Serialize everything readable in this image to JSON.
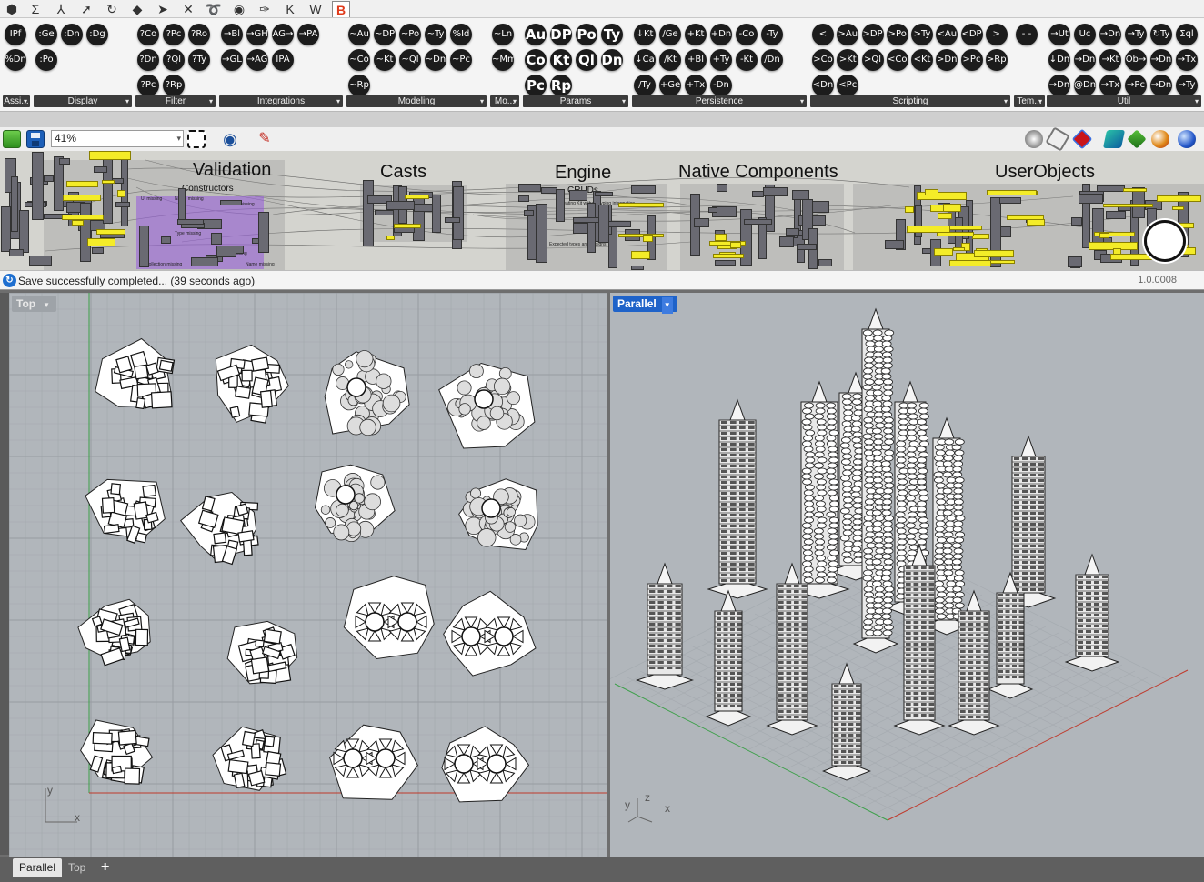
{
  "tab_strip": {
    "items": [
      {
        "glyph": "⬢",
        "name": "params-tab-icon"
      },
      {
        "glyph": "Σ",
        "name": "maths-tab-icon"
      },
      {
        "glyph": "⅄",
        "name": "sets-tab-icon"
      },
      {
        "glyph": "➚",
        "name": "vector-tab-icon"
      },
      {
        "glyph": "↻",
        "name": "curve-tab-icon"
      },
      {
        "glyph": "◆",
        "name": "surface-tab-icon"
      },
      {
        "glyph": "➤",
        "name": "mesh-tab-icon"
      },
      {
        "glyph": "✕",
        "name": "intersect-tab-icon"
      },
      {
        "glyph": "➰",
        "name": "transform-tab-icon"
      },
      {
        "glyph": "◉",
        "name": "display-tab-icon"
      },
      {
        "glyph": "✑",
        "name": "plugin-tab-icon"
      },
      {
        "glyph": "K",
        "name": "kangaroo-tab-icon"
      },
      {
        "glyph": "W",
        "name": "weaverbird-tab-icon"
      },
      {
        "glyph": "B",
        "name": "selected-plugin-tab-icon"
      }
    ]
  },
  "ribbon": {
    "panels": [
      {
        "label": "Assi...",
        "buttons": [
          "IPf",
          "%Dn"
        ]
      },
      {
        "label": "Display",
        "buttons": [
          ":Ge",
          ":Dn",
          ":Dg",
          ":Po"
        ]
      },
      {
        "label": "Filter",
        "buttons": [
          "?Co",
          "?Pc",
          "?Ro",
          "?Dn",
          "?Ql",
          "?Ty",
          "?Pc",
          "?Rp"
        ]
      },
      {
        "label": "Integrations",
        "buttons": [
          "→Bl",
          "→GH",
          "AG→",
          "→PA",
          "→GL",
          "→AG",
          "IPA"
        ]
      },
      {
        "label": "Modeling",
        "buttons": [
          "~Au",
          "~DP",
          "~Po",
          "~Ty",
          "%Id",
          "~Co",
          "~Kt",
          "~Ql",
          "~Dn",
          "~Pc",
          "~Rp"
        ]
      },
      {
        "label": "Mo...",
        "buttons": [
          "~Ln",
          "~Mm"
        ]
      },
      {
        "label": "Params",
        "buttons": [
          "Au",
          "DP",
          "Po",
          "Ty",
          "Co",
          "Kt",
          "Ql",
          "Dn",
          "Pc",
          "Rp"
        ]
      },
      {
        "label": "Persistence",
        "buttons": [
          "↓Kt",
          "/Ge",
          "+Kt",
          "+Dn",
          "-Co",
          "-Ty",
          "↓Ca",
          "/Kt",
          "+Bl",
          "+Ty",
          "-Kt",
          "/Dn",
          "/Ty",
          "+Ge",
          "+Tx",
          "-Dn"
        ]
      },
      {
        "label": "Scripting",
        "buttons": [
          "<",
          ">Au",
          ">DP",
          ">Po",
          ">Ty",
          "<Au",
          "<DP",
          ">",
          ">Co",
          ">Kt",
          ">Ql",
          "<Co",
          "<Kt",
          ">Dn",
          ">Pc",
          ">Rp",
          "<Dn",
          "<Pc"
        ]
      },
      {
        "label": "Tem...",
        "buttons": [
          "- -"
        ]
      },
      {
        "label": "Util",
        "buttons": [
          "→Ut",
          "Uc",
          "→Dn",
          "→Ty",
          "↻Ty",
          "Σql",
          "↓Dn",
          "→Dn",
          "→Kt",
          "Ob→",
          "→Dn",
          "→Tx",
          "→Dn",
          "@Dn",
          "→Tx",
          "→Pc",
          "→Dn",
          "→Ty"
        ]
      }
    ]
  },
  "toolbar": {
    "zoom_value": "41%"
  },
  "canvas": {
    "groups": [
      {
        "title": "Validation",
        "sub": "Constructors"
      },
      {
        "title": "Casts",
        "sub": ""
      },
      {
        "title": "Engine",
        "sub": "CRUDs"
      },
      {
        "title": "Native Components",
        "sub": ""
      },
      {
        "title": "UserObjects",
        "sub": ""
      }
    ],
    "validation_notes": [
      "UI missing",
      "Name missing",
      "Name missing",
      "Type missing",
      "Name missing",
      "Name missing",
      "Collection missing"
    ],
    "engine_notes": [
      "Creating Kit without typing information",
      "Expected types and designs"
    ]
  },
  "status_bar": {
    "message": "Save successfully completed... (39 seconds ago)",
    "version": "1.0.0008"
  },
  "viewports": {
    "top": {
      "label": "Top"
    },
    "parallel": {
      "label": "Parallel"
    },
    "axes_top": {
      "x": "x",
      "y": "y"
    },
    "axes_parallel": {
      "x": "x",
      "y": "y",
      "z": "z"
    }
  },
  "bottom_tabs": {
    "items": [
      "Parallel",
      "Top"
    ],
    "add": "+"
  },
  "colors": {
    "accent_blue": "#1f63c9",
    "component_yellow": "#f4ec28",
    "group_purple": "#9a5ddc",
    "viewport_bg": "#b1b6bb"
  }
}
